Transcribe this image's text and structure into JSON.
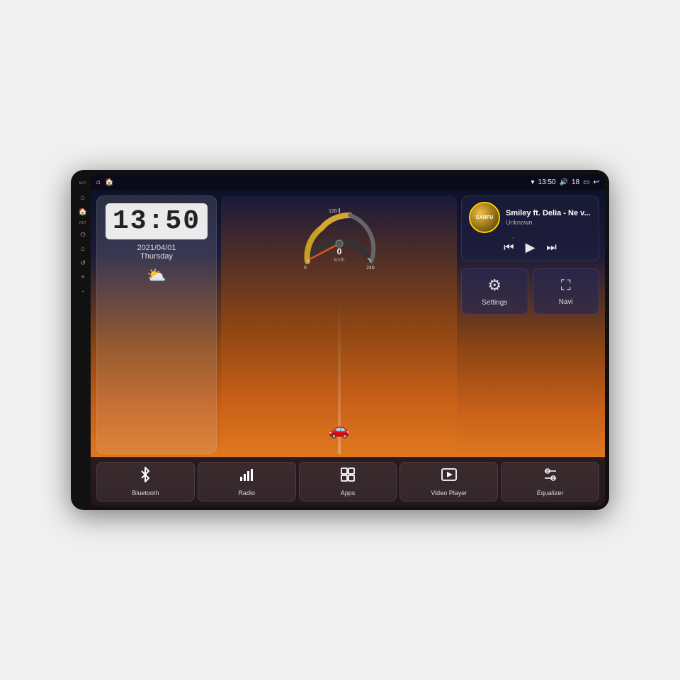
{
  "device": {
    "side_labels": {
      "mic": "MIC",
      "rst": "RST"
    }
  },
  "status_bar": {
    "left": {
      "home_icon": "⌂",
      "house_icon": "🏠"
    },
    "center": "13:50",
    "right": {
      "wifi_icon": "▾",
      "time": "13:50",
      "volume_icon": "🔊",
      "volume_level": "18",
      "battery_icon": "▭",
      "back_icon": "↩"
    }
  },
  "clock_widget": {
    "time": "13:50",
    "date": "2021/04/01",
    "day": "Thursday",
    "weather_icon": "⛅"
  },
  "speedometer": {
    "value": "0",
    "unit": "km/h",
    "max": "240"
  },
  "music_widget": {
    "title": "Smiley ft. Delia - Ne v...",
    "artist": "Unknown",
    "album_text": "CARFU",
    "prev_icon": "⏮",
    "play_icon": "▶",
    "next_icon": "⏭"
  },
  "settings_tile": {
    "icon": "⚙",
    "label": "Settings"
  },
  "navi_tile": {
    "icon": "▲",
    "label": "Navi"
  },
  "bottom_bar": [
    {
      "icon": "✦",
      "label": "Bluetooth",
      "id": "bluetooth"
    },
    {
      "icon": "📶",
      "label": "Radio",
      "id": "radio"
    },
    {
      "icon": "⊞",
      "label": "Apps",
      "id": "apps"
    },
    {
      "icon": "▶",
      "label": "Video Player",
      "id": "video-player"
    },
    {
      "icon": "⚙",
      "label": "Equalizer",
      "id": "equalizer"
    }
  ]
}
